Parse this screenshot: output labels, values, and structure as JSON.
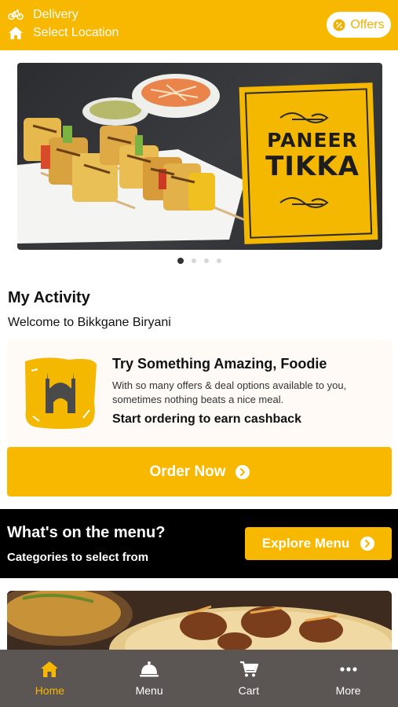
{
  "header": {
    "mode_label": "Delivery",
    "location_label": "Select Location",
    "offers_label": "Offers"
  },
  "banner": {
    "poster_line1": "PANEER",
    "poster_line2": "TIKKA",
    "slide_count": 4,
    "active_slide": 1
  },
  "activity": {
    "title": "My Activity",
    "welcome": "Welcome to Bikkgane Biryani",
    "card_title": "Try Something Amazing, Foodie",
    "card_desc": "With so many offers & deal options available to you, sometimes nothing beats a nice meal.",
    "card_cta": "Start ordering to earn cashback",
    "order_button": "Order Now"
  },
  "menu_section": {
    "title": "What's on the menu?",
    "subtitle": "Categories to select from",
    "explore_button": "Explore Menu"
  },
  "bottom_nav": {
    "items": [
      {
        "label": "Home",
        "icon": "home-icon",
        "active": true
      },
      {
        "label": "Menu",
        "icon": "cloche-icon",
        "active": false
      },
      {
        "label": "Cart",
        "icon": "cart-icon",
        "active": false
      },
      {
        "label": "More",
        "icon": "more-dots-icon",
        "active": false
      }
    ]
  },
  "colors": {
    "brand_yellow": "#f9b800",
    "nav_bg": "#5b5553",
    "strip_bg": "#000000"
  }
}
